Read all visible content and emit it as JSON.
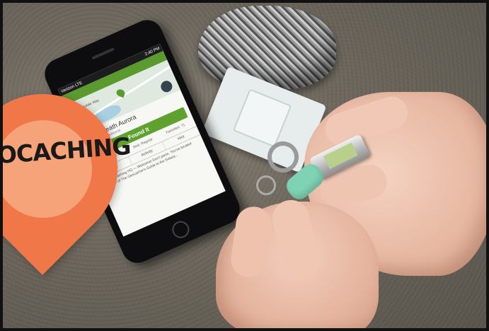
{
  "logo": {
    "text": "OCACHING",
    "color": "#f07848",
    "inner_color": "#f7a37a"
  },
  "phone": {
    "statusbar": {
      "carrier": "Verizon LTE",
      "time": "2:40 PM"
    },
    "map": {
      "street_label": "N Ridgedale Way"
    },
    "cache": {
      "title": "GT: Beneath Aurora",
      "subtitle": "Cache type: Traditional",
      "found_button": "Found It"
    },
    "stats": [
      {
        "label": "Difficulty: 1.5"
      },
      {
        "label": "Size: Regular"
      },
      {
        "label": "Favorites: 71"
      }
    ],
    "tabs": [
      "About",
      "Activity",
      "Hint"
    ],
    "description": "By: Geocaching HQ — Welcome! Don't panic. You've located another of The Geocacher's Guide to the Galaxy..."
  }
}
